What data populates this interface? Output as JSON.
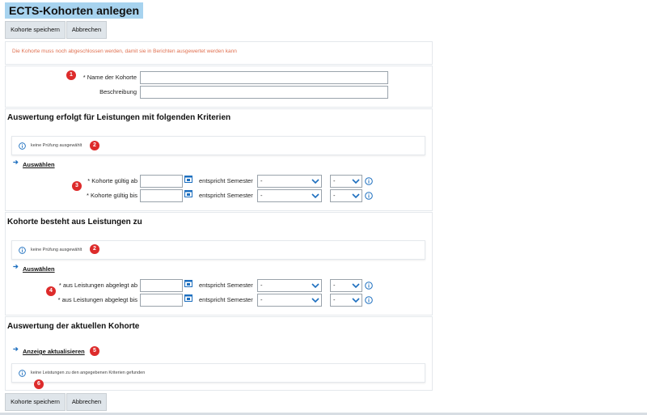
{
  "page": {
    "title": "ECTS-Kohorten anlegen",
    "save_label": "Kohorte speichern",
    "cancel_label": "Abbrechen"
  },
  "warning": "Die Kohorte muss noch abgeschlossen werden, damit sie in Berichten ausgewertet werden kann",
  "basics": {
    "name_label": "* Name der Kohorte",
    "name_value": "",
    "description_label": "Beschreibung",
    "description_value": ""
  },
  "criteria": {
    "heading": "Auswertung erfolgt für Leistungen mit folgenden Kriterien",
    "info": "keine Prüfung ausgewählt",
    "select_link": "Auswählen",
    "valid_from_label": "* Kohorte gültig ab",
    "valid_to_label": "* Kohorte gültig bis",
    "semester_label": "entspricht Semester",
    "semester_value": "-",
    "year_value": "-"
  },
  "results": {
    "heading": "Kohorte besteht aus Leistungen zu",
    "info": "keine Prüfung ausgewählt",
    "select_link": "Auswählen",
    "from_label": "* aus Leistungen abgelegt ab",
    "to_label": "* aus Leistungen abgelegt bis",
    "semester_label": "entspricht Semester",
    "semester_value": "-",
    "year_value": "-"
  },
  "evaluation": {
    "heading": "Auswertung der aktuellen Kohorte",
    "refresh_link": "Anzeige aktualisieren",
    "info": "keine Leistungen zu den angegebenen Kriterien gefunden"
  },
  "badges": [
    "1",
    "2",
    "3",
    "2",
    "4",
    "5",
    "6"
  ],
  "colors": {
    "badge": "#dd2b2b",
    "link_arrow": "#1d6fbf",
    "title_bg": "#a7d3ef",
    "warning": "#e07050"
  },
  "icons": [
    "calendar-icon",
    "info-icon",
    "chevron-down-icon",
    "arrow-right-icon"
  ]
}
